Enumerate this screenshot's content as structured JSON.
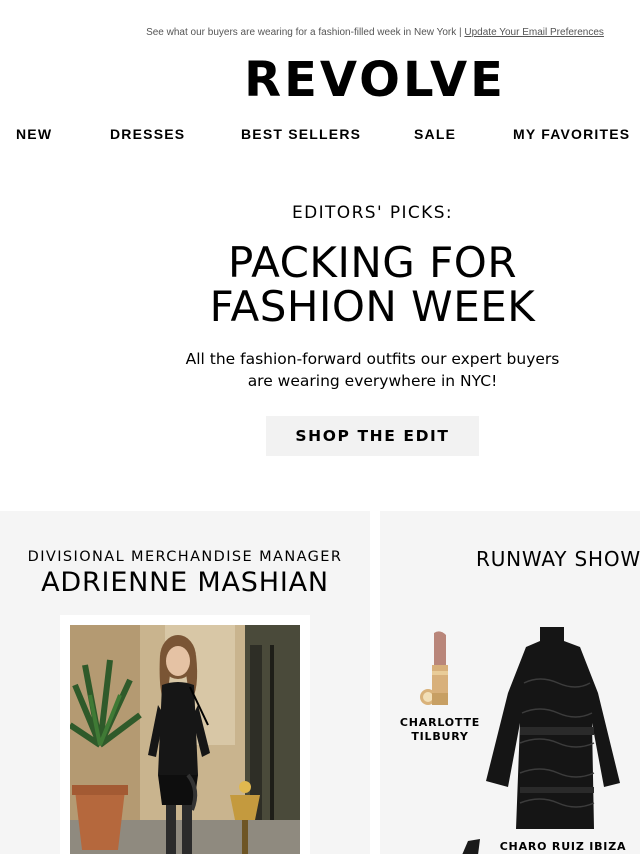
{
  "preheader": {
    "text": "See what our buyers are wearing for a fashion-filled week in New York | ",
    "link_label": "Update Your Email Preferences"
  },
  "brand": {
    "logo": "REVOLVE"
  },
  "nav": {
    "items": [
      {
        "label": "NEW"
      },
      {
        "label": "DRESSES"
      },
      {
        "label": "BEST SELLERS"
      },
      {
        "label": "SALE"
      },
      {
        "label": "MY FAVORITES"
      }
    ]
  },
  "hero": {
    "eyebrow": "EDITORS' PICKS:",
    "headline_line1": "PACKING FOR",
    "headline_line2": "FASHION WEEK",
    "subcopy": "All the fashion-forward outfits our expert buyers are wearing everywhere in NYC!",
    "cta_label": "SHOP THE EDIT"
  },
  "feature_left": {
    "role": "DIVISIONAL MERCHANDISE MANAGER",
    "name": "ADRIENNE MASHIAN"
  },
  "feature_right": {
    "title": "RUNWAY SHOW",
    "products": [
      {
        "brand": "CHARLOTTE\nTILBURY"
      },
      {
        "brand": "CHARO RUIZ IBIZA"
      }
    ]
  },
  "colors": {
    "panel_bg": "#f5f5f5",
    "cta_bg": "#f2f2f2",
    "text": "#000000"
  }
}
